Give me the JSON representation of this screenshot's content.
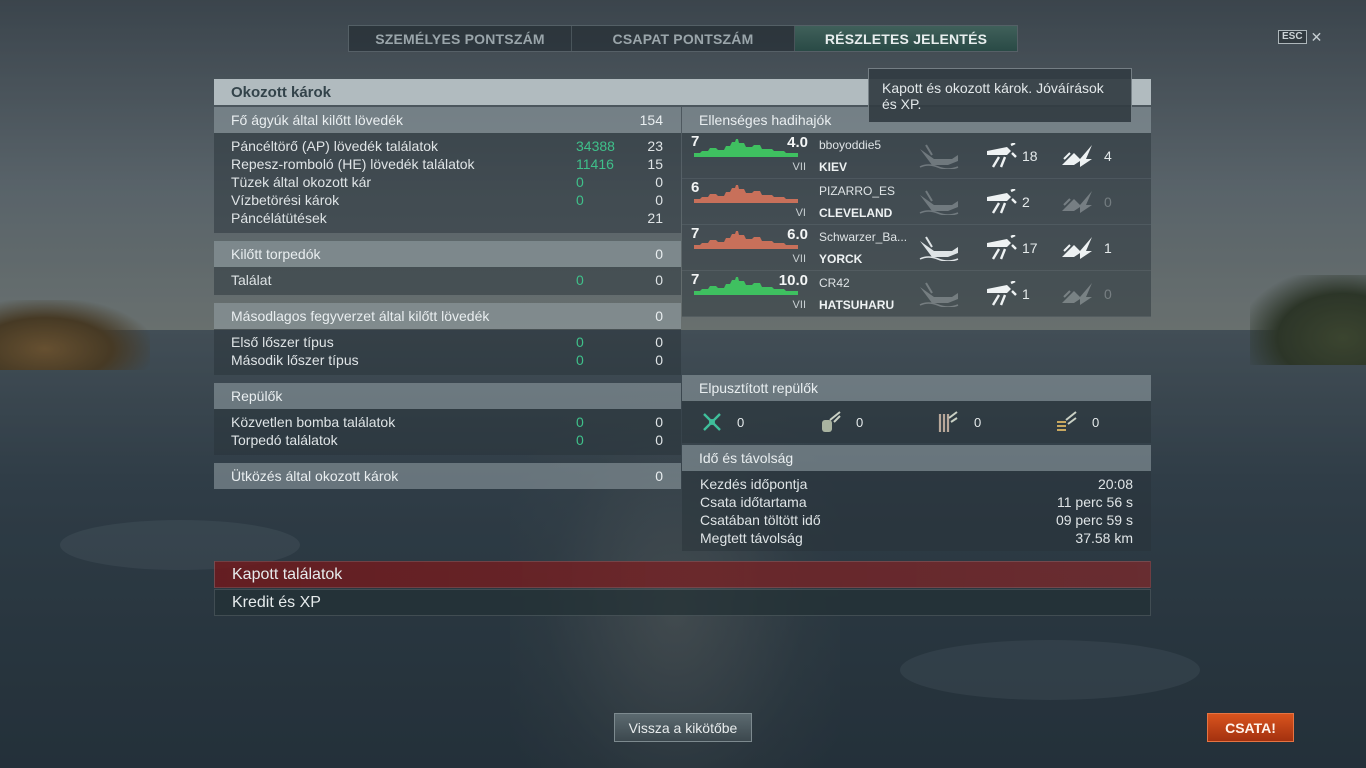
{
  "tabs": [
    {
      "label": "SZEMÉLYES PONTSZÁM",
      "active": false
    },
    {
      "label": "CSAPAT PONTSZÁM",
      "active": false
    },
    {
      "label": "RÉSZLETES JELENTÉS",
      "active": true
    }
  ],
  "esc": {
    "key": "ESC",
    "close": "✕"
  },
  "main_title": "Okozott károk",
  "tooltip": "Kapott és okozott károk. Jóváírások és XP.",
  "main_guns": {
    "title": "Fő ágyúk által kilőtt lövedék",
    "total": "154",
    "rows": [
      {
        "label": "Páncéltörő (AP) lövedék találatok",
        "dmg": "34388",
        "hits": "23"
      },
      {
        "label": "Repesz-romboló (HE) lövedék találatok",
        "dmg": "11416",
        "hits": "15"
      },
      {
        "label": "Tüzek által okozott kár",
        "dmg": "0",
        "hits": "0"
      },
      {
        "label": "Vízbetörési károk",
        "dmg": "0",
        "hits": "0"
      },
      {
        "label": "Páncélátütések",
        "dmg": "",
        "hits": "21"
      }
    ]
  },
  "torpedoes": {
    "title": "Kilőtt torpedók",
    "total": "0",
    "rows": [
      {
        "label": "Találat",
        "dmg": "0",
        "hits": "0"
      }
    ]
  },
  "secondary": {
    "title": "Másodlagos fegyverzet által kilőtt lövedék",
    "total": "0",
    "rows": [
      {
        "label": "Első lőszer típus",
        "dmg": "0",
        "hits": "0"
      },
      {
        "label": "Második lőszer típus",
        "dmg": "0",
        "hits": "0"
      }
    ]
  },
  "planes": {
    "title": "Repülők",
    "rows": [
      {
        "label": "Közvetlen bomba találatok",
        "dmg": "0",
        "hits": "0"
      },
      {
        "label": "Torpedó találatok",
        "dmg": "0",
        "hits": "0"
      }
    ]
  },
  "ramming": {
    "title": "Ütközés által okozott károk",
    "total": "0"
  },
  "enemy_ships": {
    "title": "Ellenséges hadihajók",
    "ships": [
      {
        "tier": "7",
        "hp": "4.0",
        "roman": "VII",
        "player": "bboyoddie5",
        "ship": "KIEV",
        "hits": "18",
        "fires": "4",
        "color": "#3fc060",
        "sunk": false,
        "fires_dim": false
      },
      {
        "tier": "6",
        "hp": "",
        "roman": "VI",
        "player": "PIZARRO_ES",
        "ship": "CLEVELAND",
        "hits": "2",
        "fires": "0",
        "color": "#c8705a",
        "sunk": false,
        "fires_dim": true
      },
      {
        "tier": "7",
        "hp": "6.0",
        "roman": "VII",
        "player": "Schwarzer_Ba...",
        "ship": "YORCK",
        "hits": "17",
        "fires": "1",
        "color": "#c8705a",
        "sunk": true,
        "fires_dim": false
      },
      {
        "tier": "7",
        "hp": "10.0",
        "roman": "VII",
        "player": "CR42",
        "ship": "HATSUHARU",
        "hits": "1",
        "fires": "0",
        "color": "#3fc060",
        "sunk": false,
        "fires_dim": true
      }
    ]
  },
  "planes_destroyed": {
    "title": "Elpusztított repülők",
    "items": [
      {
        "icon": "fighter-icon",
        "value": "0"
      },
      {
        "icon": "torpedo-bomber-icon",
        "value": "0"
      },
      {
        "icon": "dive-bomber-icon",
        "value": "0"
      },
      {
        "icon": "spotter-plane-icon",
        "value": "0"
      }
    ]
  },
  "time_distance": {
    "title": "Idő és távolság",
    "rows": [
      {
        "label": "Kezdés időpontja",
        "value": "20:08"
      },
      {
        "label": "Csata időtartama",
        "value": "11 perc 56 s"
      },
      {
        "label": "Csatában töltött idő",
        "value": "09 perc 59 s"
      },
      {
        "label": "Megtett távolság",
        "value": "37.58 km"
      }
    ]
  },
  "bars": {
    "received_hits": "Kapott találatok",
    "credit_xp": "Kredit és XP"
  },
  "buttons": {
    "back": "Vissza a kikötőbe",
    "battle": "CSATA!"
  }
}
